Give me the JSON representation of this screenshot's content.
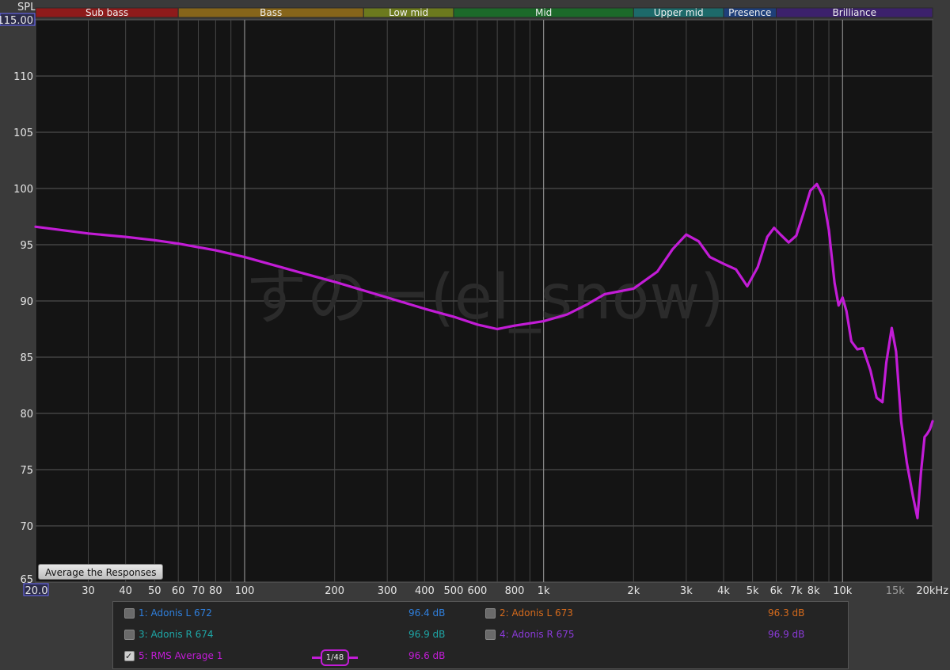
{
  "y_axis_title": "SPL",
  "bands": [
    {
      "label": "Sub bass",
      "from": 20,
      "to": 60,
      "color": "#8e1b1b"
    },
    {
      "label": "Bass",
      "from": 60,
      "to": 250,
      "color": "#86651a"
    },
    {
      "label": "Low mid",
      "from": 250,
      "to": 500,
      "color": "#6c7a1e"
    },
    {
      "label": "Mid",
      "from": 500,
      "to": 2000,
      "color": "#1c6a2a"
    },
    {
      "label": "Upper mid",
      "from": 2000,
      "to": 4000,
      "color": "#1d6a6a"
    },
    {
      "label": "Presence",
      "from": 4000,
      "to": 6000,
      "color": "#1e3f7a"
    },
    {
      "label": "Brilliance",
      "from": 6000,
      "to": 20000,
      "color": "#3c216c"
    }
  ],
  "watermark": "すのー(el_snow)",
  "average_button_label": "Average the Responses",
  "smoothing": {
    "numerator": "1",
    "denominator": "48"
  },
  "legend": [
    {
      "label": "1: Adonis L 672",
      "value": "96.4 dB",
      "color": "#2f7fdc",
      "checked": false
    },
    {
      "label": "2: Adonis L 673",
      "value": "96.3 dB",
      "color": "#d46a1c",
      "checked": false
    },
    {
      "label": "3: Adonis R 674",
      "value": "96.9 dB",
      "color": "#1ea6a6",
      "checked": false
    },
    {
      "label": "4: Adonis R 675",
      "value": "96.9 dB",
      "color": "#8a3ad8",
      "checked": false
    },
    {
      "label": "5: RMS Average 1",
      "value": "96.6 dB",
      "color": "#c21cd6",
      "checked": true
    }
  ],
  "chart_data": {
    "type": "line",
    "xscale": "log",
    "xlim": [
      20,
      20000
    ],
    "ylim": [
      65,
      115
    ],
    "ytick_labels": [
      "115.00",
      "110",
      "105",
      "100",
      "95",
      "90",
      "85",
      "80",
      "75",
      "70",
      "65"
    ],
    "yticks": [
      115,
      110,
      105,
      100,
      95,
      90,
      85,
      80,
      75,
      70,
      65
    ],
    "xtick_labels": [
      "20.0",
      "30",
      "40",
      "50",
      "60",
      "70",
      "80",
      "100",
      "200",
      "300",
      "400",
      "500",
      "600",
      "800",
      "1k",
      "2k",
      "3k",
      "4k",
      "5k",
      "6k",
      "7k",
      "8k",
      "10k",
      "15k",
      "20kHz"
    ],
    "xticks": [
      20,
      30,
      40,
      50,
      60,
      70,
      80,
      100,
      200,
      300,
      400,
      500,
      600,
      800,
      1000,
      2000,
      3000,
      4000,
      5000,
      6000,
      7000,
      8000,
      10000,
      15000,
      20000
    ],
    "grid": true,
    "series": [
      {
        "name": "5: RMS Average 1",
        "color": "#c21cd6",
        "x": [
          20,
          30,
          40,
          50,
          60,
          80,
          100,
          150,
          200,
          300,
          400,
          500,
          600,
          700,
          800,
          1000,
          1200,
          1400,
          1600,
          2000,
          2400,
          2700,
          3000,
          3300,
          3600,
          4000,
          4400,
          4800,
          5200,
          5600,
          5900,
          6200,
          6600,
          7000,
          7400,
          7800,
          8200,
          8600,
          9000,
          9400,
          9700,
          10000,
          10300,
          10700,
          11200,
          11700,
          12400,
          13000,
          13600,
          14000,
          14600,
          15100,
          15400,
          15700,
          16400,
          17200,
          17800,
          18300,
          18800,
          19200,
          19600,
          20000
        ],
        "y": [
          96.6,
          96.0,
          95.7,
          95.4,
          95.1,
          94.5,
          93.9,
          92.6,
          91.7,
          90.3,
          89.3,
          88.6,
          87.9,
          87.5,
          87.8,
          88.2,
          88.8,
          89.7,
          90.6,
          91.1,
          92.6,
          94.6,
          95.9,
          95.3,
          93.9,
          93.3,
          92.8,
          91.3,
          93.0,
          95.7,
          96.5,
          95.9,
          95.2,
          95.8,
          97.8,
          99.8,
          100.4,
          99.3,
          96.3,
          91.6,
          89.6,
          90.3,
          89.1,
          86.4,
          85.7,
          85.8,
          83.8,
          81.4,
          81.0,
          84.5,
          87.6,
          85.5,
          82.4,
          79.3,
          75.6,
          72.6,
          70.7,
          74.8,
          77.9,
          78.2,
          78.6,
          79.3
        ]
      }
    ]
  }
}
